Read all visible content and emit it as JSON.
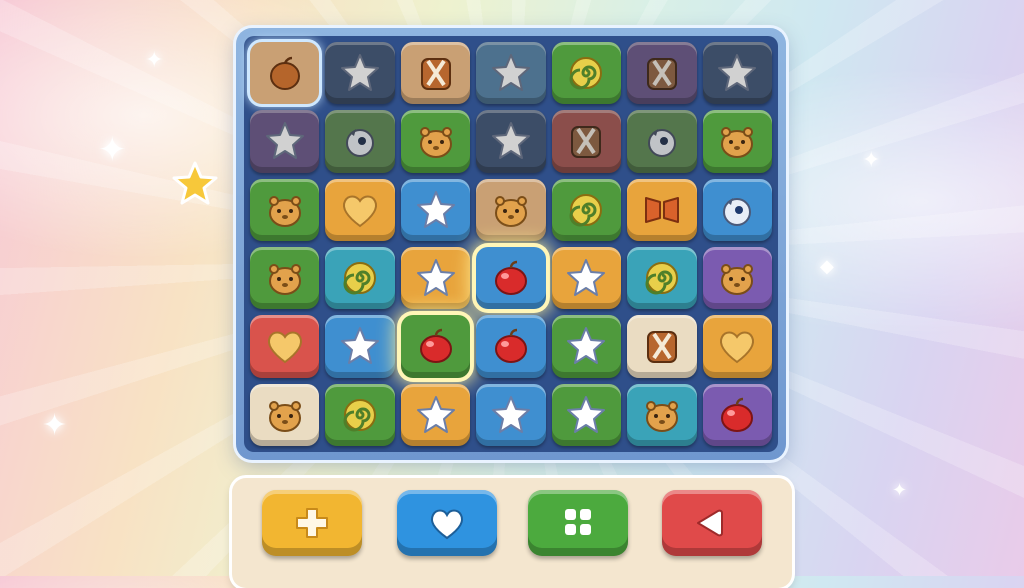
{
  "game": {
    "title": "",
    "board": {
      "rows": 6,
      "cols": 7,
      "selected_cell": [
        3,
        3
      ],
      "tiles": [
        [
          {
            "color": "tan",
            "icon": "acorn"
          },
          {
            "color": "navy",
            "icon": "star"
          },
          {
            "color": "tan",
            "icon": "backpack"
          },
          {
            "color": "blue",
            "icon": "star"
          },
          {
            "color": "green",
            "icon": "swirl"
          },
          {
            "color": "purple",
            "icon": "backpack"
          },
          {
            "color": "navy",
            "icon": "star"
          }
        ],
        [
          {
            "color": "purple",
            "icon": "star"
          },
          {
            "color": "green",
            "icon": "bird"
          },
          {
            "color": "green",
            "icon": "hamster"
          },
          {
            "color": "navy",
            "icon": "star"
          },
          {
            "color": "red",
            "icon": "backpack"
          },
          {
            "color": "green",
            "icon": "bird"
          },
          {
            "color": "green",
            "icon": "hamster"
          }
        ],
        [
          {
            "color": "green",
            "icon": "hamster"
          },
          {
            "color": "orange",
            "icon": "heart"
          },
          {
            "color": "blue",
            "icon": "star"
          },
          {
            "color": "tan",
            "icon": "hamster"
          },
          {
            "color": "green",
            "icon": "swirl"
          },
          {
            "color": "orange",
            "icon": "ribbon"
          },
          {
            "color": "blue",
            "icon": "bird"
          }
        ],
        [
          {
            "color": "green",
            "icon": "hamster"
          },
          {
            "color": "teal",
            "icon": "swirl"
          },
          {
            "color": "orange",
            "icon": "star"
          },
          {
            "color": "blue",
            "icon": "apple"
          },
          {
            "color": "orange",
            "icon": "star"
          },
          {
            "color": "teal",
            "icon": "swirl"
          },
          {
            "color": "purple",
            "icon": "hamster"
          }
        ],
        [
          {
            "color": "red",
            "icon": "heart"
          },
          {
            "color": "blue",
            "icon": "star"
          },
          {
            "color": "green",
            "icon": "apple"
          },
          {
            "color": "blue",
            "icon": "apple"
          },
          {
            "color": "green",
            "icon": "star"
          },
          {
            "color": "cream",
            "icon": "backpack"
          },
          {
            "color": "orange",
            "icon": "heart"
          }
        ],
        [
          {
            "color": "cream",
            "icon": "hamster"
          },
          {
            "color": "green",
            "icon": "swirl"
          },
          {
            "color": "orange",
            "icon": "star"
          },
          {
            "color": "blue",
            "icon": "star"
          },
          {
            "color": "green",
            "icon": "star"
          },
          {
            "color": "teal",
            "icon": "hamster"
          },
          {
            "color": "purple",
            "icon": "apple"
          }
        ]
      ]
    },
    "toolbar": {
      "buttons": [
        {
          "name": "add-button",
          "icon": "plus-icon",
          "color": "#f2b631"
        },
        {
          "name": "heart-button",
          "icon": "heart-icon",
          "color": "#2f93e0"
        },
        {
          "name": "grid-button",
          "icon": "grid-icon",
          "color": "#4caa3e"
        },
        {
          "name": "back-button",
          "icon": "back-arrow-icon",
          "color": "#e04a4a"
        }
      ]
    },
    "colors": {
      "green": "#4f9a3d",
      "blue": "#3f8fd0",
      "orange": "#e8a43c",
      "red": "#d9534c",
      "purple": "#7b5bb0",
      "cream": "#eadcc2",
      "tan": "#c9a074",
      "navy": "#3a5f99",
      "teal": "#3aa3b8"
    }
  }
}
